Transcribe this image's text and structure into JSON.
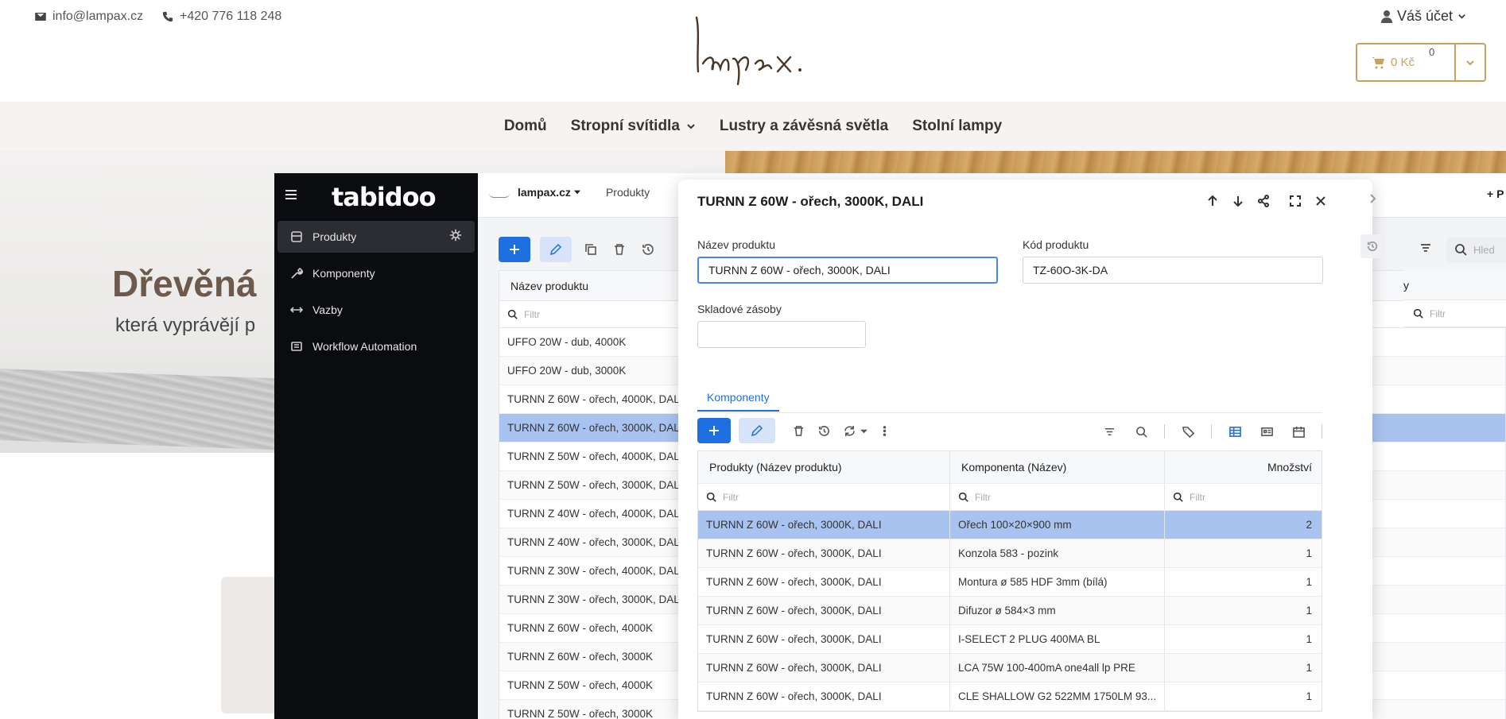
{
  "shop": {
    "email": "info@lampax.cz",
    "phone": "+420 776 118 248",
    "logo_text": "lampax.",
    "account_label": "Váš účet",
    "cart_total": "0 Kč",
    "cart_count": "0",
    "nav": [
      {
        "label": "Domů"
      },
      {
        "label": "Stropní svítidla"
      },
      {
        "label": "Lustry a závěsná světla"
      },
      {
        "label": "Stolní lampy"
      }
    ],
    "hero_title": "Dřevěná",
    "hero_subtitle": "která vyprávějí p"
  },
  "app": {
    "logo": "tabidoo",
    "app_name": "lampax.cz",
    "table_name": "Produkty",
    "add_label": "+ P",
    "search_placeholder": "Hled",
    "right_col_head": "y",
    "filter_placeholder": "Filtr",
    "sidebar": [
      {
        "label": "Produkty",
        "icon": "database-icon"
      },
      {
        "label": "Komponenty",
        "icon": "wrench-icon"
      },
      {
        "label": "Vazby",
        "icon": "arrows-icon"
      },
      {
        "label": "Workflow Automation",
        "icon": "workflow-icon"
      }
    ],
    "table": {
      "column": "Název produktu",
      "rows": [
        "UFFO 20W - dub, 4000K",
        "UFFO 20W - dub, 3000K",
        "TURNN Z 60W - ořech, 4000K, DALI",
        "TURNN Z 60W - ořech, 3000K, DALI",
        "TURNN Z 50W - ořech, 4000K, DALI",
        "TURNN Z 50W - ořech, 3000K, DALI",
        "TURNN Z 40W - ořech, 4000K, DALI",
        "TURNN Z 40W - ořech, 3000K, DALI",
        "TURNN Z 30W - ořech, 4000K, DALI",
        "TURNN Z 30W - ořech, 3000K, DALI",
        "TURNN Z 60W - ořech, 4000K",
        "TURNN Z 60W - ořech, 3000K",
        "TURNN Z 50W - ořech, 4000K",
        "TURNN Z 50W - ořech, 3000K"
      ],
      "selected_index": 3
    }
  },
  "modal": {
    "title": "TURNN Z 60W - ořech, 3000K, DALI",
    "fields": {
      "name_label": "Název produktu",
      "name_value": "TURNN Z 60W - ořech, 3000K, DALI",
      "code_label": "Kód produktu",
      "code_value": "TZ-60O-3K-DA",
      "stock_label": "Skladové zásoby",
      "stock_value": ""
    },
    "tab": "Komponenty",
    "grid": {
      "headers": [
        "Produkty (Název produktu)",
        "Komponenta (Název)",
        "Množství"
      ],
      "filter_placeholder": "Filtr",
      "rows": [
        {
          "product": "TURNN Z 60W - ořech, 3000K, DALI",
          "component": "Ořech 100×20×900 mm",
          "qty": "2"
        },
        {
          "product": "TURNN Z 60W - ořech, 3000K, DALI",
          "component": "Konzola 583 - pozink",
          "qty": "1"
        },
        {
          "product": "TURNN Z 60W - ořech, 3000K, DALI",
          "component": "Montura ø 585 HDF 3mm (bílá)",
          "qty": "1"
        },
        {
          "product": "TURNN Z 60W - ořech, 3000K, DALI",
          "component": "Difuzor ø 584×3 mm",
          "qty": "1"
        },
        {
          "product": "TURNN Z 60W - ořech, 3000K, DALI",
          "component": "I-SELECT 2 PLUG 400MA BL",
          "qty": "1"
        },
        {
          "product": "TURNN Z 60W - ořech, 3000K, DALI",
          "component": "LCA 75W 100-400mA one4all lp PRE",
          "qty": "1"
        },
        {
          "product": "TURNN Z 60W - ořech, 3000K, DALI",
          "component": "CLE SHALLOW G2 522MM 1750LM 93...",
          "qty": "1"
        }
      ],
      "selected_index": 0
    }
  },
  "colors": {
    "accent": "#1e6fe0",
    "selection": "#a9c3f0",
    "gold": "#c8a060",
    "sidebar_bg": "#0b0c10"
  }
}
